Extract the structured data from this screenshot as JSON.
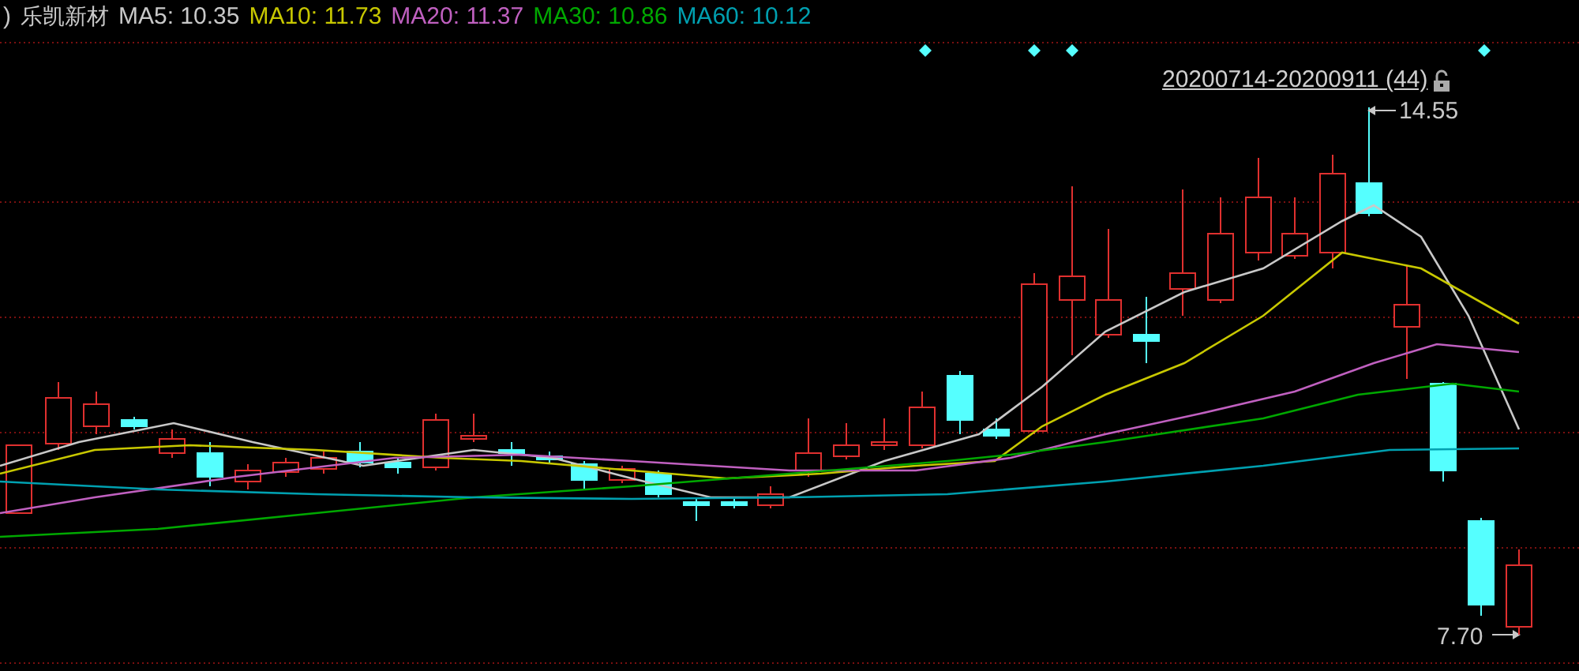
{
  "header": {
    "prefix": ")",
    "stock_name": "乐凯新材",
    "indicators": [
      {
        "label": "MA5: 10.35",
        "color": "#c8c8c8"
      },
      {
        "label": "MA10: 11.73",
        "color": "#c8c800"
      },
      {
        "label": "MA20: 11.37",
        "color": "#c060c0"
      },
      {
        "label": "MA30: 10.86",
        "color": "#00a800"
      },
      {
        "label": "MA60: 10.12",
        "color": "#00a0b0"
      }
    ]
  },
  "chart": {
    "date_range": "20200714-20200911 (44)",
    "locked": false,
    "high_label": "14.55",
    "low_label": "7.70"
  }
}
